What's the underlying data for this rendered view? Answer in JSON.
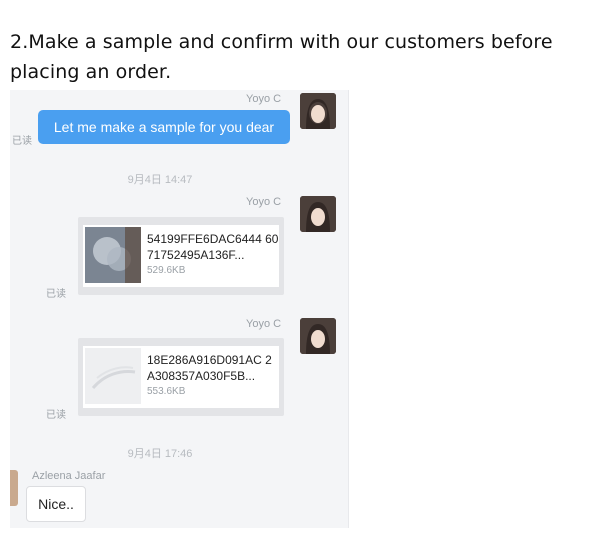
{
  "page": {
    "title": "2.Make a sample and confirm with our customers before placing an order."
  },
  "chat": {
    "messages": [
      {
        "sender": "Yoyo C",
        "text": "Let me make a sample for you dear",
        "status": "已读"
      },
      {
        "timestamp": "9月4日 14:47"
      },
      {
        "sender": "Yoyo C",
        "file_name": "54199FFE6DAC6444 6071752495A136F...",
        "file_size": "529.6KB",
        "status": "已读"
      },
      {
        "sender": "Yoyo C",
        "file_name": "18E286A916D091AC 2A308357A030F5B...",
        "file_size": "553.6KB",
        "status": "已读"
      },
      {
        "timestamp": "9月4日 17:46"
      },
      {
        "sender": "Azleena  Jaafar",
        "text": "Nice.."
      }
    ]
  },
  "colors": {
    "outgoing_bubble": "#4a9ff0",
    "chat_background": "#f4f5f7",
    "file_card": "#e3e4e7"
  },
  "icons": {
    "avatar": "user-photo-avatar",
    "file_thumbnail": "image-thumbnail-icon"
  }
}
